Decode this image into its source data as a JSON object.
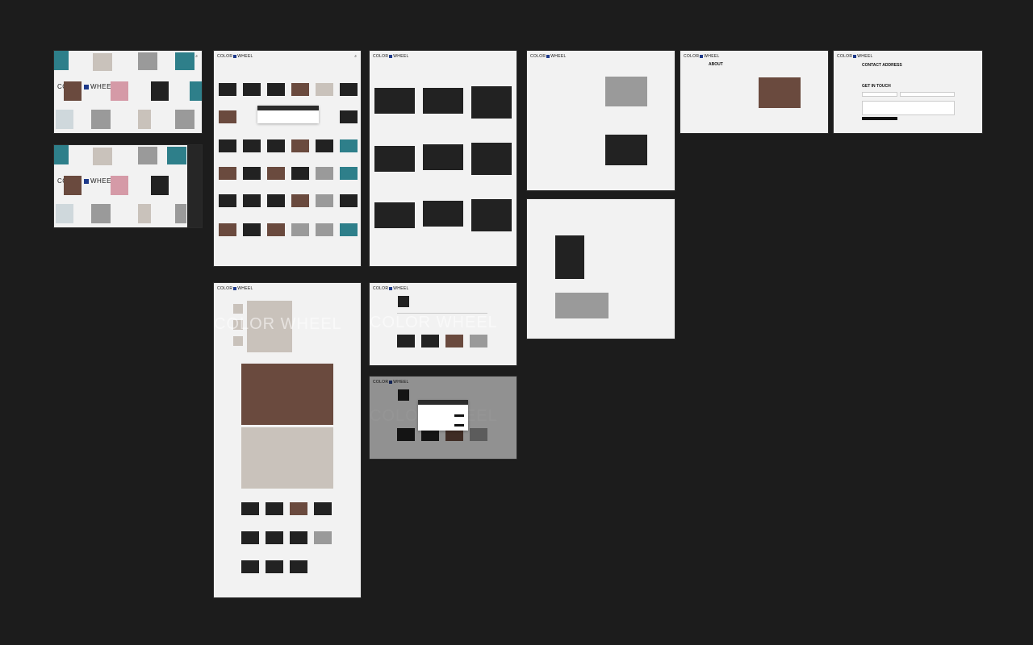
{
  "brand": {
    "left": "COLOR",
    "right": "WHEEL",
    "full": "COLOR WHEEL"
  },
  "icons": {
    "search": "search-icon",
    "close": "close-icon",
    "menu": "menu-icon"
  },
  "hero": {
    "title_left": "COLOR",
    "title_right": "WHEEL"
  },
  "about": {
    "title": "ABOUT"
  },
  "contact": {
    "title": "CONTACT ADDRESS",
    "get_in_touch": "GET IN TOUCH"
  },
  "ghost": {
    "text": "COLOR WHEEL"
  },
  "colors": {
    "background": "#1c1c1c",
    "board": "#f2f2f2",
    "accent": "#1e3a8a"
  }
}
